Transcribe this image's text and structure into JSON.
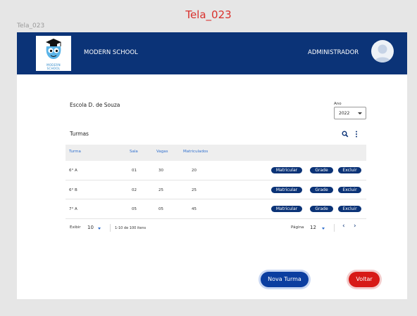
{
  "screen": {
    "title": "Tela_023",
    "label": "Tela_023"
  },
  "header": {
    "logo_text_1": "MODERN",
    "logo_text_2": "SCHOOL",
    "school_name": "MODERN SCHOOL",
    "user_role": "ADMINISTRADOR"
  },
  "school": {
    "name": "Escola D. de Souza"
  },
  "year": {
    "label": "Ano",
    "value": "2022"
  },
  "classes": {
    "title": "Turmas",
    "columns": [
      "Turma",
      "Sala",
      "Vagas",
      "Matriculados"
    ],
    "rows": [
      {
        "turma": "6° A",
        "sala": "01",
        "vagas": "30",
        "matriculados": "20"
      },
      {
        "turma": "6° B",
        "sala": "02",
        "vagas": "25",
        "matriculados": "25"
      },
      {
        "turma": "7° A",
        "sala": "05",
        "vagas": "05",
        "matriculados": "45"
      }
    ],
    "actions": {
      "enroll": "Matricular",
      "grade": "Grade",
      "delete": "Excluir"
    }
  },
  "pagination": {
    "show_label": "Exibir",
    "page_size": "10",
    "range": "1-10 de 100 itens",
    "page_label": "Página",
    "page": "12",
    "prev": "‹",
    "next": "›"
  },
  "buttons": {
    "new_class": "Nova Turma",
    "back": "Voltar"
  },
  "colors": {
    "header": "#0b3377",
    "primary": "#0b3ea0",
    "danger": "#d71a17",
    "title_red": "#d9302c",
    "link_blue": "#2f6fce"
  }
}
